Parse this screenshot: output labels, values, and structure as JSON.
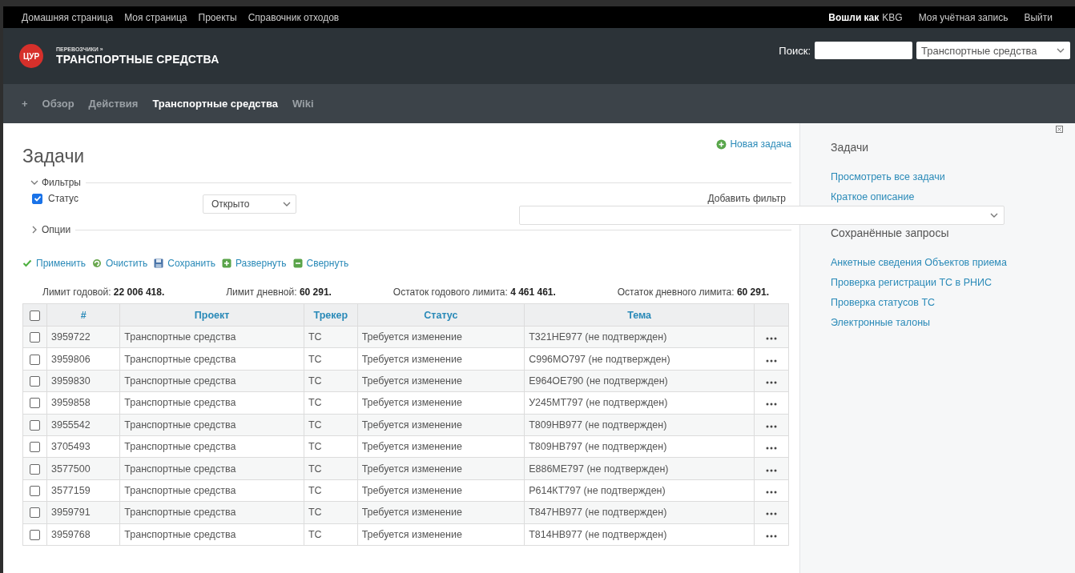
{
  "top_menu": {
    "links": [
      "Домашняя страница",
      "Моя страница",
      "Проекты",
      "Справочник отходов"
    ],
    "logged_in_label": "Вошли как",
    "logged_in_user": "KBG",
    "account_links": [
      "Моя учётная запись",
      "Выйти"
    ]
  },
  "header": {
    "logo": "ЦУР",
    "parent": "ПЕРЕВОЗЧИКИ »",
    "title": "ТРАНСПОРТНЫЕ СРЕДСТВА",
    "search_label": "Поиск:",
    "scope": "Транспортные средства"
  },
  "main_menu": [
    {
      "label": "+",
      "selected": false
    },
    {
      "label": "Обзор",
      "selected": false
    },
    {
      "label": "Действия",
      "selected": false
    },
    {
      "label": "Транспортные средства",
      "selected": true
    },
    {
      "label": "Wiki",
      "selected": false
    }
  ],
  "content": {
    "title": "Задачи",
    "new_issue": "Новая задача",
    "filters": {
      "legend": "Фильтры",
      "expanded": true,
      "rows": [
        {
          "label": "Статус",
          "checked": true,
          "operator": "Открыто"
        }
      ],
      "add_filter_label": "Добавить фильтр"
    },
    "options": {
      "legend": "Опции",
      "expanded": false
    },
    "actions": [
      {
        "kind": "apply",
        "label": "Применить"
      },
      {
        "kind": "clear",
        "label": "Очистить"
      },
      {
        "kind": "save",
        "label": "Сохранить"
      },
      {
        "kind": "expand",
        "label": "Развернуть"
      },
      {
        "kind": "collapse",
        "label": "Свернуть"
      }
    ],
    "limits": [
      {
        "label": "Лимит годовой:",
        "value": "22 006 418."
      },
      {
        "label": "Лимит дневной:",
        "value": "60 291."
      },
      {
        "label": "Остаток годового лимита:",
        "value": "4 461 461."
      },
      {
        "label": "Остаток дневного лимита:",
        "value": "60 291."
      }
    ],
    "table": {
      "select_all_checked": false,
      "columns": [
        "#",
        "Проект",
        "Трекер",
        "Статус",
        "Тема"
      ],
      "rows": [
        {
          "checked": false,
          "cells": [
            "3959722",
            "Транспортные средства",
            "ТС",
            "Требуется изменение",
            "Т321НЕ977 (не подтвержден)"
          ]
        },
        {
          "checked": false,
          "cells": [
            "3959806",
            "Транспортные средства",
            "ТС",
            "Требуется изменение",
            "С996МО797 (не подтвержден)"
          ]
        },
        {
          "checked": false,
          "cells": [
            "3959830",
            "Транспортные средства",
            "ТС",
            "Требуется изменение",
            "Е964ОЕ790 (не подтвержден)"
          ]
        },
        {
          "checked": false,
          "cells": [
            "3959858",
            "Транспортные средства",
            "ТС",
            "Требуется изменение",
            "У245МТ797 (не подтвержден)"
          ]
        },
        {
          "checked": false,
          "cells": [
            "3955542",
            "Транспортные средства",
            "ТС",
            "Требуется изменение",
            "Т809НВ977 (не подтвержден)"
          ]
        },
        {
          "checked": false,
          "cells": [
            "3705493",
            "Транспортные средства",
            "ТС",
            "Требуется изменение",
            "Т809НВ797 (не подтвержден)"
          ]
        },
        {
          "checked": false,
          "cells": [
            "3577500",
            "Транспортные средства",
            "ТС",
            "Требуется изменение",
            "Е886МЕ797 (не подтвержден)"
          ]
        },
        {
          "checked": false,
          "cells": [
            "3577159",
            "Транспортные средства",
            "ТС",
            "Требуется изменение",
            "Р614КТ797 (не подтвержден)"
          ]
        },
        {
          "checked": false,
          "cells": [
            "3959791",
            "Транспортные средства",
            "ТС",
            "Требуется изменение",
            "Т847НВ977 (не подтвержден)"
          ]
        },
        {
          "checked": false,
          "cells": [
            "3959768",
            "Транспортные средства",
            "ТС",
            "Требуется изменение",
            "Т814НВ977 (не подтвержден)"
          ]
        }
      ]
    }
  },
  "sidebar": {
    "sections": [
      {
        "heading": "Задачи",
        "links": [
          "Просмотреть все задачи",
          "Краткое описание"
        ]
      },
      {
        "heading": "Сохранённые запросы",
        "links": [
          "Анкетные сведения Объектов приема",
          "Проверка регистрации ТС в РНИС",
          "Проверка статусов ТС",
          "Электронные талоны"
        ]
      }
    ]
  }
}
